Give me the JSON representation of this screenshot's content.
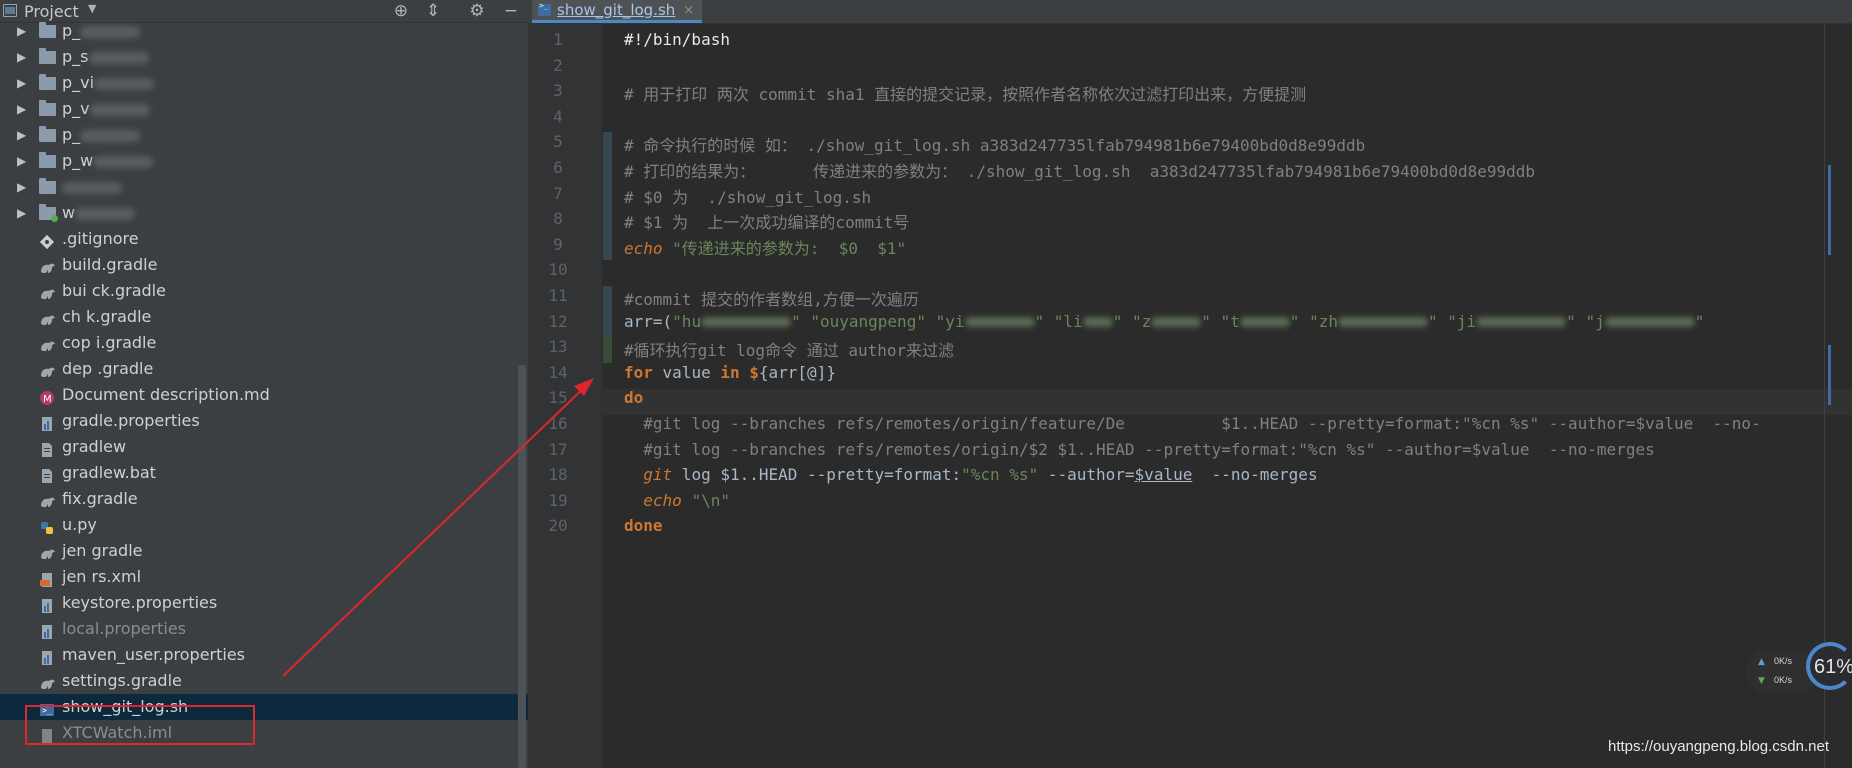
{
  "project_panel": {
    "title": "Project",
    "toolbar_icons": [
      "crosshair-icon",
      "collapse-icon",
      "gear-icon",
      "minimize-icon"
    ],
    "items": [
      {
        "label": "p_",
        "type": "folder",
        "expandable": true,
        "obscured": true
      },
      {
        "label": "p_s",
        "type": "folder",
        "expandable": true,
        "obscured": true
      },
      {
        "label": "p_vi",
        "type": "folder",
        "expandable": true,
        "obscured": true
      },
      {
        "label": "p_v",
        "type": "folder",
        "expandable": true,
        "obscured": true
      },
      {
        "label": "p_",
        "type": "folder",
        "expandable": true,
        "obscured": true
      },
      {
        "label": "p_w",
        "type": "folder",
        "expandable": true,
        "obscured": true
      },
      {
        "label": "",
        "type": "folder",
        "expandable": true,
        "obscured": true
      },
      {
        "label": "w",
        "type": "folder-git",
        "expandable": true,
        "obscured": true
      },
      {
        "label": ".gitignore",
        "type": "git"
      },
      {
        "label": "build.gradle",
        "type": "gradle"
      },
      {
        "label": "bui   ck.gradle",
        "type": "gradle"
      },
      {
        "label": "ch   k.gradle",
        "type": "gradle"
      },
      {
        "label": "cop   i.gradle",
        "type": "gradle"
      },
      {
        "label": "dep   .gradle",
        "type": "gradle"
      },
      {
        "label": "Document description.md",
        "type": "markdown"
      },
      {
        "label": "gradle.properties",
        "type": "properties"
      },
      {
        "label": "gradlew",
        "type": "file"
      },
      {
        "label": "gradlew.bat",
        "type": "file"
      },
      {
        "label": "   fix.gradle",
        "type": "gradle"
      },
      {
        "label": "   u.py",
        "type": "python"
      },
      {
        "label": "jen   gradle",
        "type": "gradle"
      },
      {
        "label": "jen   rs.xml",
        "type": "xml"
      },
      {
        "label": "keystore.properties",
        "type": "properties"
      },
      {
        "label": "local.properties",
        "type": "properties",
        "dim": true
      },
      {
        "label": "maven_user.properties",
        "type": "properties"
      },
      {
        "label": "settings.gradle",
        "type": "gradle"
      },
      {
        "label": "show_git_log.sh",
        "type": "shell",
        "selected": true
      },
      {
        "label": "XTCWatch.iml",
        "type": "iml",
        "dim": true
      }
    ]
  },
  "editor": {
    "tab": {
      "label": "show_git_log.sh",
      "close": "×"
    },
    "lines": [
      {
        "n": "1",
        "html": "#!/bin/bash",
        "cls": "shebang"
      },
      {
        "n": "2",
        "html": ""
      },
      {
        "n": "3",
        "html": "# 用于打印 两次 commit sha1 直接的提交记录，按照作者名称依次过滤打印出来，方便提测",
        "cls": "cmt"
      },
      {
        "n": "4",
        "html": ""
      },
      {
        "n": "5",
        "html": "# 命令执行的时候 如： ./show_git_log.sh a383d247735lfab794981b6e79400bd0d8e99ddb",
        "cls": "cmt"
      },
      {
        "n": "6",
        "html": "# 打印的结果为：      传递进来的参数为： ./show_git_log.sh  a383d247735lfab794981b6e79400bd0d8e99ddb",
        "cls": "cmt"
      },
      {
        "n": "7",
        "html": "# $0 为  ./show_git_log.sh",
        "cls": "cmt"
      },
      {
        "n": "8",
        "html": "# $1 为  上一次成功编译的commit号",
        "cls": "cmt"
      },
      {
        "n": "9",
        "html": "echo",
        "rest": " \"传递进来的参数为:  $0  $1\"",
        "cls": "echo"
      },
      {
        "n": "10",
        "html": ""
      },
      {
        "n": "11",
        "html": "#commit 提交的作者数组,方便一次遍历",
        "cls": "cmt"
      },
      {
        "n": "12",
        "html": "arr=(\"hu\" \"ouyangpeng\" \"yi\" \"li\" \"z\" \"t\" \"zh\" \"ji\" \"j\"",
        "cls": "arr"
      },
      {
        "n": "13",
        "html": "#循环执行git log命令 通过 author来过滤",
        "cls": "cmt caret"
      },
      {
        "n": "14",
        "html": "for value in ${arr[@]}",
        "cls": "for"
      },
      {
        "n": "15",
        "html": "do",
        "cls": "kwline"
      },
      {
        "n": "16",
        "html": "  #git log --branches refs/remotes/origin/feature/De          $1..HEAD --pretty=format:\"%cn %s\" --author=$value  --no-",
        "cls": "cmt"
      },
      {
        "n": "17",
        "html": "  #git log --branches refs/remotes/origin/$2 $1..HEAD --pretty=format:\"%cn %s\" --author=$value  --no-merges",
        "cls": "cmt"
      },
      {
        "n": "18",
        "html": "  git log $1..HEAD --pretty=format:\"%cn %s\" --author=$value  --no-merges",
        "cls": "gitline"
      },
      {
        "n": "19",
        "html": "  echo \"\\n\"",
        "cls": "echo2"
      },
      {
        "n": "20",
        "html": "done",
        "cls": "kwline"
      }
    ]
  },
  "net_widget": {
    "up_value": "0K/s",
    "down_value": "0K/s",
    "percent": "61%"
  },
  "watermark": "https://ouyangpeng.blog.csdn.net",
  "colors": {
    "selection": "#0d293e",
    "annotation_red": "#e0262c",
    "keyword": "#cc7832",
    "string": "#6a8759",
    "comment": "#808080"
  }
}
